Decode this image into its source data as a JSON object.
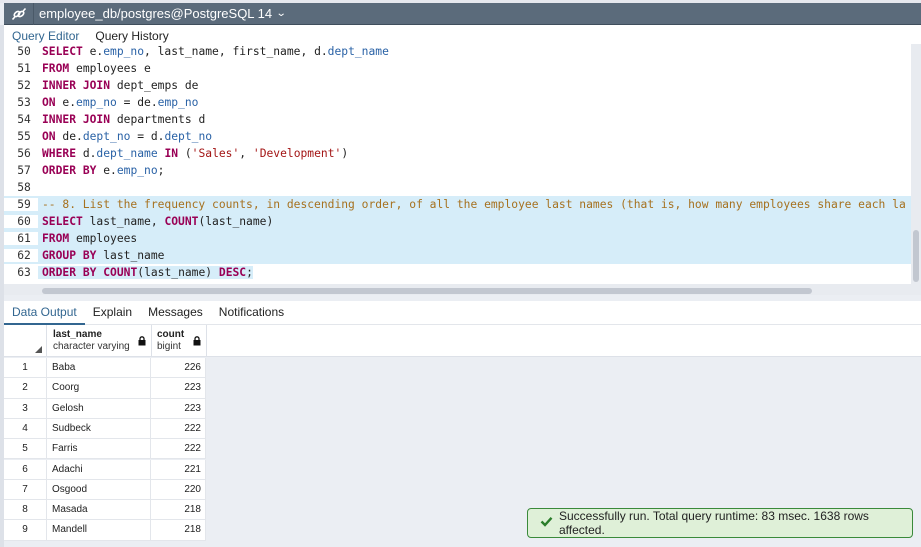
{
  "titlebar": {
    "connection_icon": "connection-icon",
    "title": "employee_db/postgres@PostgreSQL 14",
    "dropdown_icon": "chevron-down-icon"
  },
  "editor_tabs": [
    {
      "label": "Query Editor",
      "active": true
    },
    {
      "label": "Query History",
      "active": false
    }
  ],
  "editor": {
    "lines": [
      {
        "n": "50",
        "text": "SELECT e.emp_no, last_name, first_name, d.dept_name"
      },
      {
        "n": "51",
        "text": "FROM employees e"
      },
      {
        "n": "52",
        "text": "INNER JOIN dept_emps de"
      },
      {
        "n": "53",
        "text": "ON e.emp_no = de.emp_no"
      },
      {
        "n": "54",
        "text": "INNER JOIN departments d"
      },
      {
        "n": "55",
        "text": "ON de.dept_no = d.dept_no"
      },
      {
        "n": "56",
        "text": "WHERE d.dept_name IN ('Sales', 'Development')"
      },
      {
        "n": "57",
        "text": "ORDER BY e.emp_no;"
      },
      {
        "n": "58",
        "text": ""
      },
      {
        "n": "59",
        "text": "-- 8. List the frequency counts, in descending order, of all the employee last names (that is, how many employees share each la"
      },
      {
        "n": "60",
        "text": "SELECT last_name, COUNT(last_name)"
      },
      {
        "n": "61",
        "text": "FROM employees"
      },
      {
        "n": "62",
        "text": "GROUP BY last_name"
      },
      {
        "n": "63",
        "text": "ORDER BY COUNT(last_name) DESC;"
      }
    ],
    "selected_lines": [
      "59",
      "60",
      "61",
      "62",
      "63"
    ]
  },
  "output_tabs": [
    {
      "label": "Data Output",
      "active": true
    },
    {
      "label": "Explain",
      "active": false
    },
    {
      "label": "Messages",
      "active": false
    },
    {
      "label": "Notifications",
      "active": false
    }
  ],
  "grid": {
    "columns": [
      {
        "name": "last_name",
        "type": "character varying",
        "locked": true
      },
      {
        "name": "count",
        "type": "bigint",
        "locked": true
      }
    ],
    "rows": [
      {
        "n": "1",
        "last_name": "Baba",
        "count": "226"
      },
      {
        "n": "2",
        "last_name": "Coorg",
        "count": "223"
      },
      {
        "n": "3",
        "last_name": "Gelosh",
        "count": "223"
      },
      {
        "n": "4",
        "last_name": "Sudbeck",
        "count": "222"
      },
      {
        "n": "5",
        "last_name": "Farris",
        "count": "222"
      },
      {
        "n": "6",
        "last_name": "Adachi",
        "count": "221"
      },
      {
        "n": "7",
        "last_name": "Osgood",
        "count": "220"
      },
      {
        "n": "8",
        "last_name": "Masada",
        "count": "218"
      },
      {
        "n": "9",
        "last_name": "Mandell",
        "count": "218"
      }
    ]
  },
  "toast": {
    "icon": "checkmark-icon",
    "message": "Successfully run. Total query runtime: 83 msec. 1638 rows affected."
  },
  "colors": {
    "titlebar_bg": "#5b6b7b",
    "accent": "#326690",
    "keyword": "#990055",
    "identifier": "#2a62a6",
    "string": "#a31515",
    "comment": "#a6711f",
    "selection": "#d6edf9",
    "toast_bg": "#dff0d8",
    "toast_border": "#3a8a3a"
  }
}
